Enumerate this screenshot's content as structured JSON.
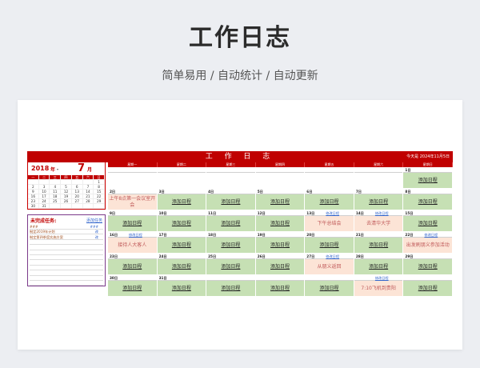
{
  "hero": {
    "title": "工作日志",
    "subtitle": "简单易用  /  自动统计  /  自动更新"
  },
  "sheet": {
    "title": "工 作 日 志",
    "today_label": "今天是 2024年11月5日",
    "year": "2018",
    "year_unit": "年",
    "month": "7",
    "month_unit": "月",
    "mini_weekdays": [
      "一",
      "二",
      "三",
      "四",
      "五",
      "六",
      "日"
    ],
    "mini_days": [
      [
        "",
        "",
        "",
        "",
        "",
        "",
        "1"
      ],
      [
        "2",
        "3",
        "4",
        "5",
        "6",
        "7",
        "8"
      ],
      [
        "9",
        "10",
        "11",
        "12",
        "13",
        "14",
        "15"
      ],
      [
        "16",
        "17",
        "18",
        "19",
        "20",
        "21",
        "22"
      ],
      [
        "23",
        "24",
        "25",
        "26",
        "27",
        "28",
        "29"
      ],
      [
        "30",
        "31",
        "",
        "",
        "",
        "",
        ""
      ]
    ],
    "tasks_title": "未完成任务:",
    "tasks_add": "添加任务",
    "tasks": [
      {
        "text": "###",
        "mark": "###"
      },
      {
        "text": "制定2019年计划",
        "mark": "改"
      },
      {
        "text": "制定第四季度实施方案",
        "mark": "改"
      }
    ],
    "weekdays": [
      "星期一",
      "星期二",
      "星期三",
      "星期四",
      "星期五",
      "星期六",
      "星期日"
    ],
    "view_label": "修改日程",
    "weeks": [
      [
        {
          "day": "",
          "view": "",
          "text": "",
          "type": "empty"
        },
        {
          "day": "",
          "view": "",
          "text": "",
          "type": "empty"
        },
        {
          "day": "",
          "view": "",
          "text": "",
          "type": "empty"
        },
        {
          "day": "",
          "view": "",
          "text": "",
          "type": "empty"
        },
        {
          "day": "",
          "view": "",
          "text": "",
          "type": "empty"
        },
        {
          "day": "",
          "view": "",
          "text": "",
          "type": "empty"
        },
        {
          "day": "1日",
          "view": "",
          "text": "添加日程",
          "type": "add"
        }
      ],
      [
        {
          "day": "2日",
          "view": "",
          "text": "上午8点第一会议室开会",
          "type": "note"
        },
        {
          "day": "3日",
          "view": "",
          "text": "添加日程",
          "type": "add"
        },
        {
          "day": "4日",
          "view": "",
          "text": "添加日程",
          "type": "add"
        },
        {
          "day": "5日",
          "view": "",
          "text": "添加日程",
          "type": "add"
        },
        {
          "day": "6日",
          "view": "",
          "text": "添加日程",
          "type": "add"
        },
        {
          "day": "7日",
          "view": "",
          "text": "添加日程",
          "type": "add"
        },
        {
          "day": "8日",
          "view": "",
          "text": "添加日程",
          "type": "add"
        }
      ],
      [
        {
          "day": "9日",
          "view": "",
          "text": "添加日程",
          "type": "add"
        },
        {
          "day": "10日",
          "view": "",
          "text": "添加日程",
          "type": "add"
        },
        {
          "day": "11日",
          "view": "",
          "text": "添加日程",
          "type": "add"
        },
        {
          "day": "12日",
          "view": "",
          "text": "添加日程",
          "type": "add"
        },
        {
          "day": "13日",
          "view": "修改日程",
          "text": "下午总结会",
          "type": "note"
        },
        {
          "day": "14日",
          "view": "修改日程",
          "text": "去清华大学",
          "type": "note"
        },
        {
          "day": "15日",
          "view": "",
          "text": "添加日程",
          "type": "add"
        }
      ],
      [
        {
          "day": "16日",
          "view": "修改日程",
          "text": "接待人大客人",
          "type": "note"
        },
        {
          "day": "17日",
          "view": "",
          "text": "添加日程",
          "type": "add"
        },
        {
          "day": "18日",
          "view": "",
          "text": "添加日程",
          "type": "add"
        },
        {
          "day": "19日",
          "view": "",
          "text": "添加日程",
          "type": "add"
        },
        {
          "day": "20日",
          "view": "",
          "text": "添加日程",
          "type": "add"
        },
        {
          "day": "21日",
          "view": "",
          "text": "添加日程",
          "type": "add"
        },
        {
          "day": "22日",
          "view": "修改日程",
          "text": "出发刷朋义参加活动",
          "type": "note"
        }
      ],
      [
        {
          "day": "23日",
          "view": "",
          "text": "添加日程",
          "type": "add"
        },
        {
          "day": "24日",
          "view": "",
          "text": "添加日程",
          "type": "add"
        },
        {
          "day": "25日",
          "view": "",
          "text": "添加日程",
          "type": "add"
        },
        {
          "day": "26日",
          "view": "",
          "text": "添加日程",
          "type": "add"
        },
        {
          "day": "27日",
          "view": "修改日程",
          "text": "从朋义返回",
          "type": "note"
        },
        {
          "day": "28日",
          "view": "",
          "text": "添加日程",
          "type": "add"
        },
        {
          "day": "29日",
          "view": "",
          "text": "添加日程",
          "type": "add"
        }
      ],
      [
        {
          "day": "30日",
          "view": "",
          "text": "添加日程",
          "type": "add"
        },
        {
          "day": "31日",
          "view": "",
          "text": "添加日程",
          "type": "add"
        },
        {
          "day": "",
          "view": "",
          "text": "添加日程",
          "type": "add"
        },
        {
          "day": "",
          "view": "",
          "text": "添加日程",
          "type": "add"
        },
        {
          "day": "",
          "view": "",
          "text": "添加日程",
          "type": "add"
        },
        {
          "day": "",
          "view": "修改日程",
          "text": "7:10飞机到贵阳",
          "type": "note"
        },
        {
          "day": "",
          "view": "",
          "text": "添加日程",
          "type": "add"
        }
      ]
    ]
  }
}
